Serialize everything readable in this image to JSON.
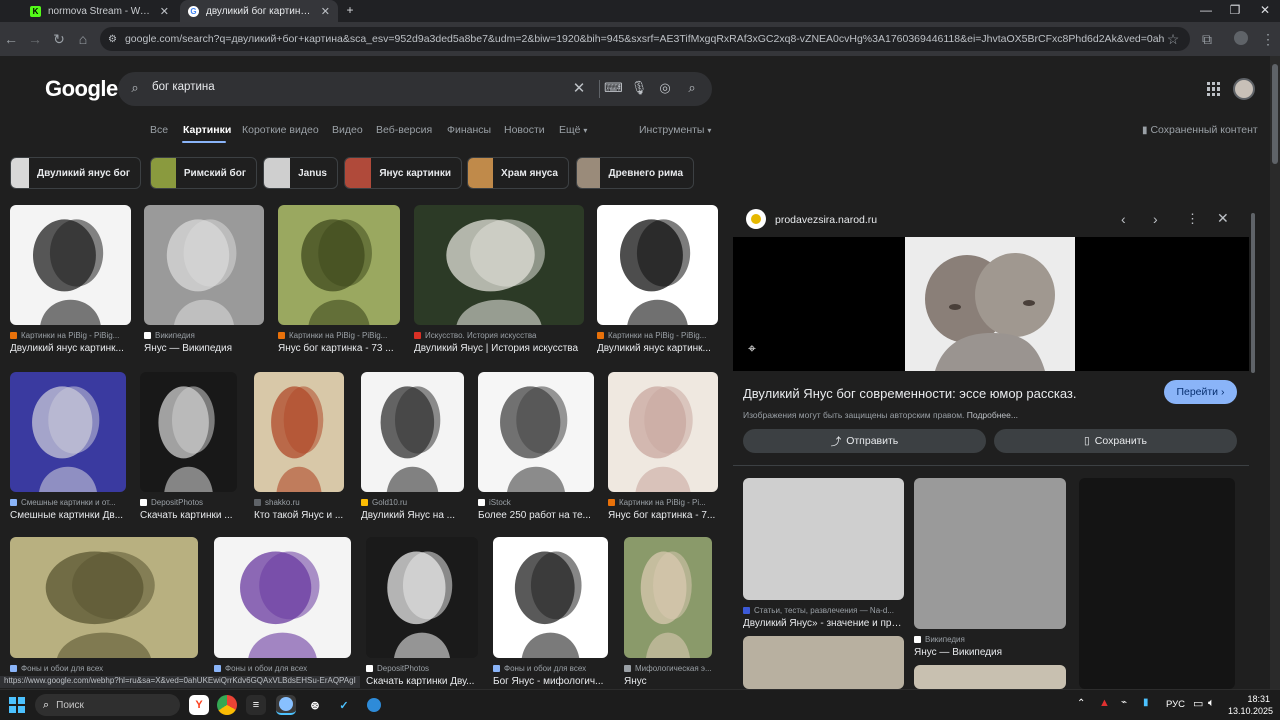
{
  "tabs": [
    {
      "title": "normova Stream - Watch Live o",
      "active": false,
      "favicon_color": "#53fc18",
      "favicon_letter": "K"
    },
    {
      "title": "двуликий бог картина - Поис",
      "active": true,
      "favicon_color": "#ffffff",
      "favicon_letter": "G"
    }
  ],
  "browser": {
    "url": "google.com/search?q=двуликий+бог+картина&sca_esv=952d9a3ded5a8be7&udm=2&biw=1920&bih=945&sxsrf=AE3TifMxgqRxRAf3xGC2xq8-vZNEA0cvHg%3A1760369446118&ei=JhvtaOX5BrCFxc8Phd6d2Ak&ved=0ahUKEwjlpImcv6GQAxWwQ..."
  },
  "search": {
    "logo": "Google",
    "query": "бог картина",
    "nav_tabs": [
      "Все",
      "Картинки",
      "Короткие видео",
      "Видео",
      "Веб-версия",
      "Финансы",
      "Новости",
      "Ещё",
      "Инструменты"
    ],
    "active_tab": "Картинки",
    "saved_content": "Сохраненный контент"
  },
  "chips": [
    {
      "label": "Двуликий янус бог",
      "color": "#d8d8d8"
    },
    {
      "label": "Римский бог",
      "color": "#8a9a3e"
    },
    {
      "label": "Janus",
      "color": "#cfcfcf"
    },
    {
      "label": "Янус картинки",
      "color": "#b04a3a"
    },
    {
      "label": "Храм януса",
      "color": "#c08a4a"
    },
    {
      "label": "Древнего рима",
      "color": "#9a8b7a"
    }
  ],
  "results": [
    {
      "source": "Картинки на PiBig - PiBig...",
      "title": "Двуликий янус картинк...",
      "bg": "#f4f4f4",
      "fg": "#222222",
      "src_color": "#e8710a"
    },
    {
      "source": "Википедия",
      "title": "Янус — Википедия",
      "bg": "#9a9a9a",
      "fg": "#d8d8d8",
      "src_color": "#ffffff"
    },
    {
      "source": "Картинки на PiBig - PiBig...",
      "title": "Янус бог картинка - 73 ...",
      "bg": "#9aa860",
      "fg": "#3f4a1e",
      "src_color": "#e8710a"
    },
    {
      "source": "Искусство. История искусства",
      "title": "Двуликий Янус | История искусства",
      "bg": "#2c3a26",
      "fg": "#e0e0d8",
      "src_color": "#d93025"
    },
    {
      "source": "Картинки на PiBig - PiBig...",
      "title": "Двуликий янус картинк...",
      "bg": "#ffffff",
      "fg": "#111111",
      "src_color": "#e8710a"
    },
    {
      "source": "Смешные картинки и от...",
      "title": "Смешные картинки Дв...",
      "bg": "#3a3aa0",
      "fg": "#c8c8d8",
      "src_color": "#8ab4f8"
    },
    {
      "source": "DepositPhotos",
      "title": "Скачать картинки ...",
      "bg": "#181818",
      "fg": "#cfcfcf",
      "src_color": "#ffffff"
    },
    {
      "source": "shakko.ru",
      "title": "Кто такой Янус и ...",
      "bg": "#d8c8a8",
      "fg": "#b04a2a",
      "src_color": "#5f6368"
    },
    {
      "source": "Gold10.ru",
      "title": "Двуликий Янус на ...",
      "bg": "#f4f4f4",
      "fg": "#333333",
      "src_color": "#fbbc04"
    },
    {
      "source": "iStock",
      "title": "Более 250 работ на те...",
      "bg": "#f6f6f6",
      "fg": "#444444",
      "src_color": "#ffffff"
    },
    {
      "source": "Картинки на PiBig - Pi...",
      "title": "Янус бог картинка - 7...",
      "bg": "#efe8e0",
      "fg": "#c9a8a0",
      "src_color": "#e8710a"
    },
    {
      "source": "Фоны и обои для всех",
      "title": "",
      "bg": "#b8b080",
      "fg": "#5a5632",
      "src_color": "#8ab4f8"
    },
    {
      "source": "Фоны и обои для всех",
      "title": "",
      "bg": "#f4f4f4",
      "fg": "#6a3aa0",
      "src_color": "#8ab4f8"
    },
    {
      "source": "DepositPhotos",
      "title": "Скачать картинки Дву...",
      "bg": "#1a1a1a",
      "fg": "#e8e8e8",
      "src_color": "#ffffff"
    },
    {
      "source": "Фоны и обои для всех",
      "title": "Бог Янус - мифологич...",
      "bg": "#ffffff",
      "fg": "#222222",
      "src_color": "#8ab4f8"
    },
    {
      "source": "Мифологическая э...",
      "title": "Янус",
      "bg": "#8a9a6a",
      "fg": "#d8c8b0",
      "src_color": "#9aa0a6"
    }
  ],
  "status_url": "https://www.google.com/webhp?hl=ru&sa=X&ved=0ahUKEwiQrrKdv6GQAxVLBdsEHSu-ErAQPAgI",
  "panel": {
    "site": "prodavezsira.narod.ru",
    "title": "Двуликий Янус бог современности: эссе юмор рассказ.",
    "visit": "Перейти",
    "notice": "Изображения могут быть защищены авторским правом.",
    "more": "Подробнее...",
    "share": "Отправить",
    "save": "Сохранить",
    "related": [
      {
        "source": "Статьи, тесты, развлечения — Na-d...",
        "title": "Двуликий Янус» - значение и про...",
        "bg": "#cfcfcf",
        "src_color": "#3c5ad8"
      },
      {
        "source": "Википедия",
        "title": "Янус — Википедия",
        "bg": "#9a9a9a",
        "src_color": "#ffffff"
      },
      {
        "source": "",
        "title": "",
        "bg": "#141414",
        "src_color": "#ffffff"
      }
    ]
  },
  "taskbar": {
    "search_placeholder": "Поиск",
    "lang": "РУС",
    "time": "18:31",
    "date": "13.10.2025"
  }
}
